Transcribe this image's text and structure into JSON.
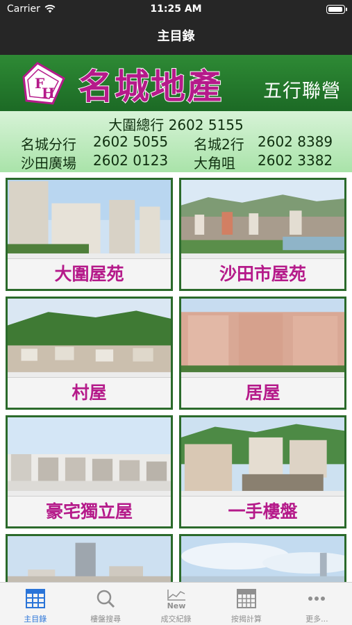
{
  "status": {
    "carrier": "Carrier",
    "time": "11:25 AM"
  },
  "nav": {
    "title": "主目錄"
  },
  "banner": {
    "brand": "名城地產",
    "union": "五行聯營",
    "hq": "大圍總行 2602 5155",
    "branches": [
      {
        "name": "名城分行",
        "phone": "2602 5055"
      },
      {
        "name": "名城2行",
        "phone": "2602 8389"
      },
      {
        "name": "沙田廣場",
        "phone": "2602 0123"
      },
      {
        "name": "大角咀",
        "phone": "2602 3382"
      }
    ],
    "colors": {
      "green": "#1c6a25",
      "magenta": "#b51a8a",
      "light_green": "#bfeabf"
    }
  },
  "tiles": [
    {
      "label": "大圍屋苑",
      "scene": "tower-estate"
    },
    {
      "label": "沙田市屋苑",
      "scene": "city-aerial"
    },
    {
      "label": "村屋",
      "scene": "village-hill"
    },
    {
      "label": "居屋",
      "scene": "hos-blocks"
    },
    {
      "label": "豪宅獨立屋",
      "scene": "townhouses"
    },
    {
      "label": "一手樓盤",
      "scene": "new-development"
    },
    {
      "label": "",
      "scene": "skyline-tower"
    },
    {
      "label": "",
      "scene": "harbour-sky"
    }
  ],
  "tabbar": {
    "active_color": "#2a74d8",
    "items": [
      {
        "label": "主目錄",
        "icon": "grid-icon",
        "active": true
      },
      {
        "label": "樓盤搜尋",
        "icon": "search-icon",
        "active": false
      },
      {
        "label": "成交紀錄",
        "icon": "new-chart-icon",
        "active": false
      },
      {
        "label": "按揭計算",
        "icon": "calculator-icon",
        "active": false
      },
      {
        "label": "更多...",
        "icon": "more-icon",
        "active": false
      }
    ]
  }
}
